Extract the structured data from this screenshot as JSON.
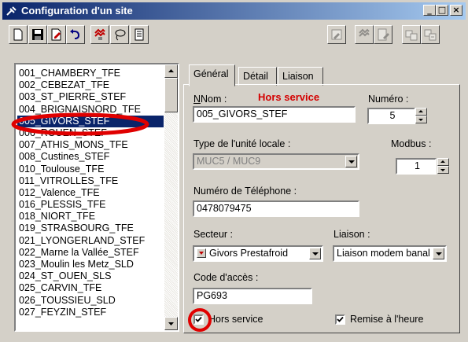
{
  "window": {
    "title": "Configuration d'un site",
    "caption_buttons": [
      "_",
      "□",
      "×"
    ]
  },
  "toolbar": {
    "buttons": [
      "new-document-icon",
      "save-icon",
      "edit-document-icon",
      "undo-icon",
      "connect-icon",
      "lasso-icon",
      "report-icon",
      "form-icon",
      "dispatch-icon",
      "verify-icon",
      "copy-site-icon",
      "paste-site-icon"
    ]
  },
  "site_list": {
    "items": [
      "001_CHAMBERY_TFE",
      "002_CEBEZAT_TFE",
      "003_ST_PIERRE_STEF",
      "004_BRIGNAISNORD_TFE",
      "005_GIVORS_STEF",
      "006_ROUEN_STEF",
      "007_ATHIS_MONS_TFE",
      "008_Custines_STEF",
      "010_Toulouse_TFE",
      "011_VITROLLES_TFE",
      "012_Valence_TFE",
      "016_PLESSIS_TFE",
      "018_NIORT_TFE",
      "019_STRASBOURG_TFE",
      "021_LYONGERLAND_STEF",
      "022_Marne la Vallée_STEF",
      "023_Moulin les Metz_SLD",
      "024_ST_OUEN_SLS",
      "025_CARVIN_TFE",
      "026_TOUSSIEU_SLD",
      "027_FEYZIN_STEF"
    ],
    "selected_index": 4
  },
  "tabs": [
    "Général",
    "Détail",
    "Liaison"
  ],
  "general": {
    "nom_label": "Nom :",
    "status_banner": "Hors service",
    "numero_label": "Numéro :",
    "nom_value": "005_GIVORS_STEF",
    "numero_value": "5",
    "type_label": "Type de l'unité locale :",
    "modbus_label": "Modbus :",
    "type_value": "MUC5 / MUC9",
    "modbus_value": "1",
    "tel_label": "Numéro de Téléphone :",
    "tel_value": "0478079475",
    "secteur_label": "Secteur :",
    "liaison_label": "Liaison :",
    "secteur_value": "Givors Prestafroid",
    "liaison_value": "Liaison modem banal",
    "code_label": "Code d'accès :",
    "code_value": "PG693",
    "hors_service_label": "Hors service",
    "remise_label": "Remise à l'heure",
    "hors_service_checked": true,
    "remise_checked": true
  },
  "colors": {
    "titlebar": "#0a246a",
    "selection": "#0a246a",
    "status_text": "#d40000",
    "annotation": "#e00000"
  }
}
